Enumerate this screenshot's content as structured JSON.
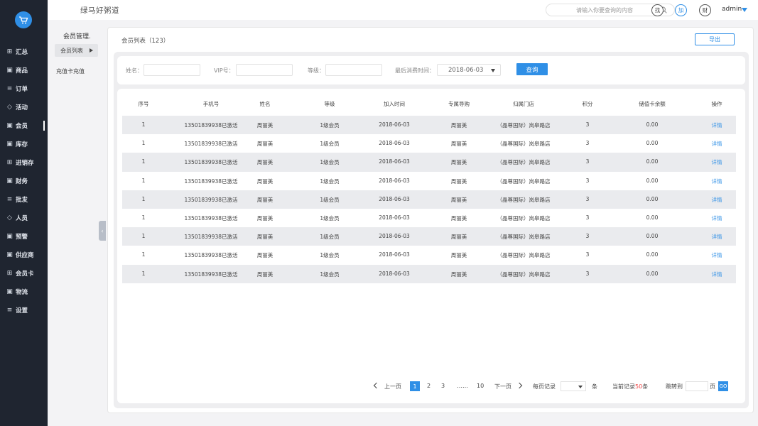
{
  "brand": "绿马好粥道",
  "search": {
    "placeholder": "请输入你要查询的内容"
  },
  "top_actions": [
    "找",
    "加",
    "财"
  ],
  "user": "admin",
  "sidebar": {
    "items": [
      {
        "label": "汇总",
        "icon": "grid-icon"
      },
      {
        "label": "商品",
        "icon": "box-icon"
      },
      {
        "label": "订单",
        "icon": "list-icon"
      },
      {
        "label": "活动",
        "icon": "tag-icon"
      },
      {
        "label": "会员",
        "icon": "member-icon",
        "active": true
      },
      {
        "label": "库存",
        "icon": "box-icon"
      },
      {
        "label": "进销存",
        "icon": "grid-icon"
      },
      {
        "label": "财务",
        "icon": "box-icon"
      },
      {
        "label": "批发",
        "icon": "list-icon"
      },
      {
        "label": "人员",
        "icon": "tag-icon"
      },
      {
        "label": "预警",
        "icon": "box-icon"
      },
      {
        "label": "供应商",
        "icon": "box-icon"
      },
      {
        "label": "会员卡",
        "icon": "grid-icon"
      },
      {
        "label": "物流",
        "icon": "box-icon"
      },
      {
        "label": "设置",
        "icon": "list-icon"
      }
    ]
  },
  "submenu": {
    "title": "会员管理.",
    "active": "会员列表",
    "item": "充值卡充值"
  },
  "panel": {
    "title": "会员列表（123）",
    "export": "导出"
  },
  "filter": {
    "name_label": "姓名：",
    "vip_label": "VIP号：",
    "level_label": "等级：",
    "last_label": "最后消费时间：",
    "date": "2018-06-03",
    "query": "查询"
  },
  "table": {
    "headers": [
      "序号",
      "手机号",
      "姓名",
      "等级",
      "加入时间",
      "专属导购",
      "归属门店",
      "积分",
      "储值卡余额",
      "操作"
    ],
    "rows": [
      [
        "1",
        "13501839938已激活",
        "周丽美",
        "1级会员",
        "2018-06-03",
        "周丽美",
        "（晶尊国际）岚皋路店",
        "3",
        "0.00",
        "详情"
      ],
      [
        "1",
        "13501839938已激活",
        "周丽美",
        "1级会员",
        "2018-06-03",
        "周丽美",
        "（晶尊国际）岚皋路店",
        "3",
        "0.00",
        "详情"
      ],
      [
        "1",
        "13501839938已激活",
        "周丽美",
        "1级会员",
        "2018-06-03",
        "周丽美",
        "（晶尊国际）岚皋路店",
        "3",
        "0.00",
        "详情"
      ],
      [
        "1",
        "13501839938已激活",
        "周丽美",
        "1级会员",
        "2018-06-03",
        "周丽美",
        "（晶尊国际）岚皋路店",
        "3",
        "0.00",
        "详情"
      ],
      [
        "1",
        "13501839938已激活",
        "周丽美",
        "1级会员",
        "2018-06-03",
        "周丽美",
        "（晶尊国际）岚皋路店",
        "3",
        "0.00",
        "详情"
      ],
      [
        "1",
        "13501839938已激活",
        "周丽美",
        "1级会员",
        "2018-06-03",
        "周丽美",
        "（晶尊国际）岚皋路店",
        "3",
        "0.00",
        "详情"
      ],
      [
        "1",
        "13501839938已激活",
        "周丽美",
        "1级会员",
        "2018-06-03",
        "周丽美",
        "（晶尊国际）岚皋路店",
        "3",
        "0.00",
        "详情"
      ],
      [
        "1",
        "13501839938已激活",
        "周丽美",
        "1级会员",
        "2018-06-03",
        "周丽美",
        "（晶尊国际）岚皋路店",
        "3",
        "0.00",
        "详情"
      ],
      [
        "1",
        "13501839938已激活",
        "周丽美",
        "1级会员",
        "2018-06-03",
        "周丽美",
        "（晶尊国际）岚皋路店",
        "3",
        "0.00",
        "详情"
      ]
    ]
  },
  "pager": {
    "prev": "上一页",
    "pages": [
      "1",
      "2",
      "3",
      "……",
      "10"
    ],
    "current": "1",
    "next": "下一页",
    "per_page_label": "每页记录",
    "per_page_unit": "条",
    "current_label": "当前记录",
    "current_count": "50",
    "current_unit": "条",
    "jump_label": "跳转到",
    "page_unit": "页",
    "go": "GO"
  },
  "colors": {
    "accent": "#2f8fe6",
    "sidebar": "#1f2530"
  }
}
